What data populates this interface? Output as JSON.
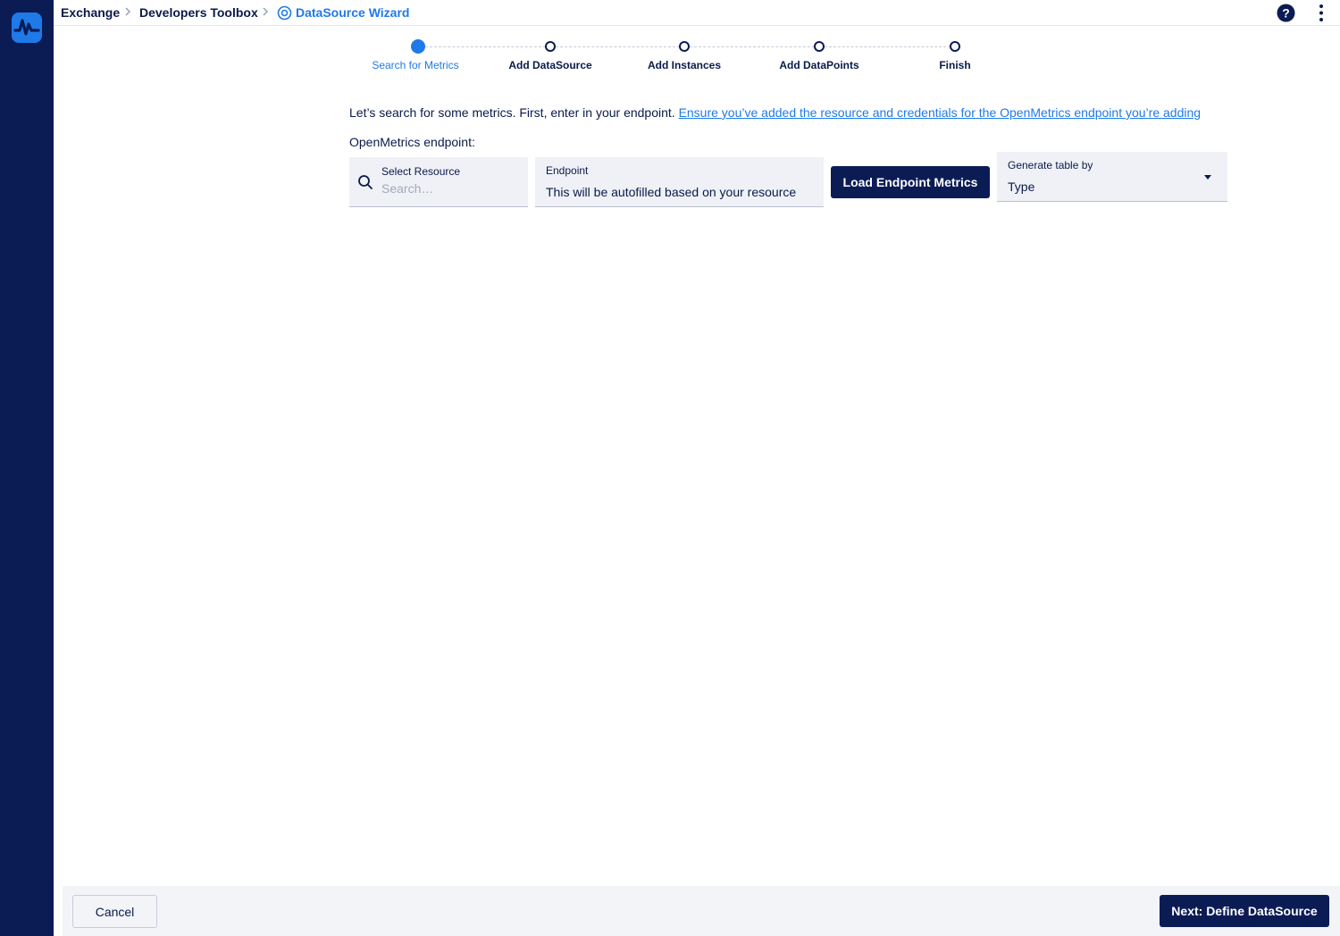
{
  "breadcrumb": {
    "items": [
      "Exchange",
      "Developers Toolbox"
    ],
    "current": "DataSource Wizard"
  },
  "topbar": {
    "icons": [
      "help-icon",
      "more-vertical-icon"
    ]
  },
  "stepper": {
    "steps": [
      {
        "label": "Search for Metrics",
        "active": true
      },
      {
        "label": "Add DataSource",
        "active": false
      },
      {
        "label": "Add Instances",
        "active": false
      },
      {
        "label": "Add DataPoints",
        "active": false
      },
      {
        "label": "Finish",
        "active": false
      }
    ]
  },
  "main": {
    "intro_text": "Let’s search for some metrics. First, enter in your endpoint.",
    "intro_link": "Ensure you’ve added the resource and credentials for the OpenMetrics endpoint you’re adding",
    "endpoint_label": "OpenMetrics endpoint:",
    "resource_field": {
      "label": "Select Resource",
      "placeholder": "Search…",
      "value": ""
    },
    "endpoint_field": {
      "label": "Endpoint",
      "value": "This will be autofilled based on your resource"
    },
    "load_button": "Load Endpoint Metrics",
    "generate_select": {
      "label": "Generate table by",
      "value": "Type"
    }
  },
  "footer": {
    "cancel": "Cancel",
    "next": "Next: Define DataSource"
  },
  "colors": {
    "rail": "#0b1c55",
    "accent": "#1f7ae8",
    "primary_button": "#0b1c55",
    "field_bg": "#eff1f6"
  }
}
